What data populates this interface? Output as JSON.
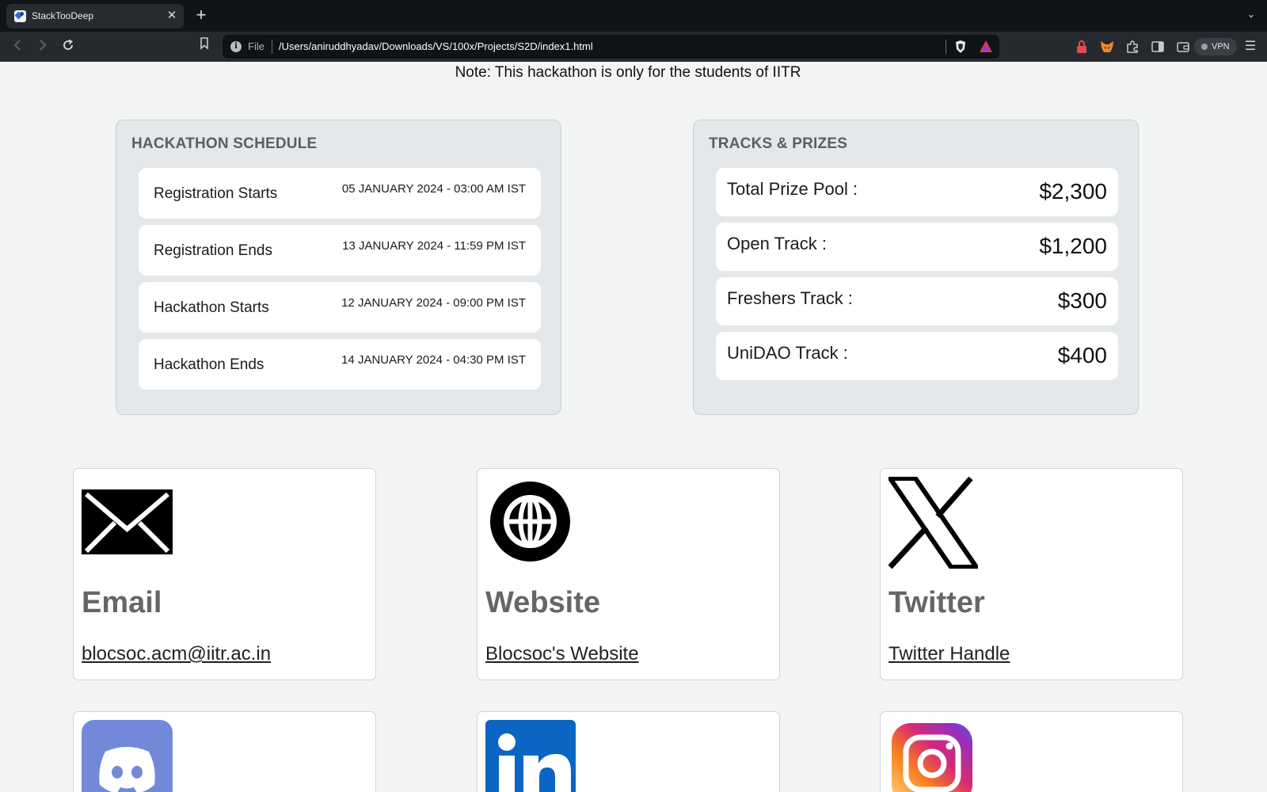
{
  "browser": {
    "tab_title": "StackTooDeep",
    "url_scheme": "File",
    "url_path": "/Users/aniruddhyadav/Downloads/VS/100x/Projects/S2D/index1.html",
    "vpn_label": "VPN"
  },
  "page": {
    "note": "Note: This hackathon is only for the students of IITR",
    "schedule": {
      "title": "HACKATHON SCHEDULE",
      "items": [
        {
          "label": "Registration Starts",
          "date": "05 JANUARY 2024 - 03:00 AM IST"
        },
        {
          "label": "Registration Ends",
          "date": "13 JANUARY 2024 - 11:59 PM IST"
        },
        {
          "label": "Hackathon Starts",
          "date": "12 JANUARY 2024 - 09:00 PM IST"
        },
        {
          "label": "Hackathon Ends",
          "date": "14 JANUARY 2024 - 04:30 PM IST"
        }
      ]
    },
    "prizes": {
      "title": "TRACKS & PRIZES",
      "items": [
        {
          "label": "Total Prize Pool :",
          "amount": "$2,300"
        },
        {
          "label": "Open Track :",
          "amount": "$1,200"
        },
        {
          "label": "Freshers Track :",
          "amount": "$300"
        },
        {
          "label": "UniDAO Track :",
          "amount": "$400"
        }
      ]
    },
    "contacts": [
      {
        "title": "Email",
        "link": "blocsoc.acm@iitr.ac.in",
        "icon": "envelope-icon"
      },
      {
        "title": "Website",
        "link": "Blocsoc's Website",
        "icon": "globe-icon"
      },
      {
        "title": "Twitter",
        "link": "Twitter Handle",
        "icon": "x-logo-icon"
      }
    ],
    "social_row2": [
      {
        "icon": "discord-icon",
        "color": "#7289da"
      },
      {
        "icon": "linkedin-icon",
        "color": "#0a66c2"
      },
      {
        "icon": "instagram-icon",
        "color": "#d62976"
      }
    ]
  }
}
